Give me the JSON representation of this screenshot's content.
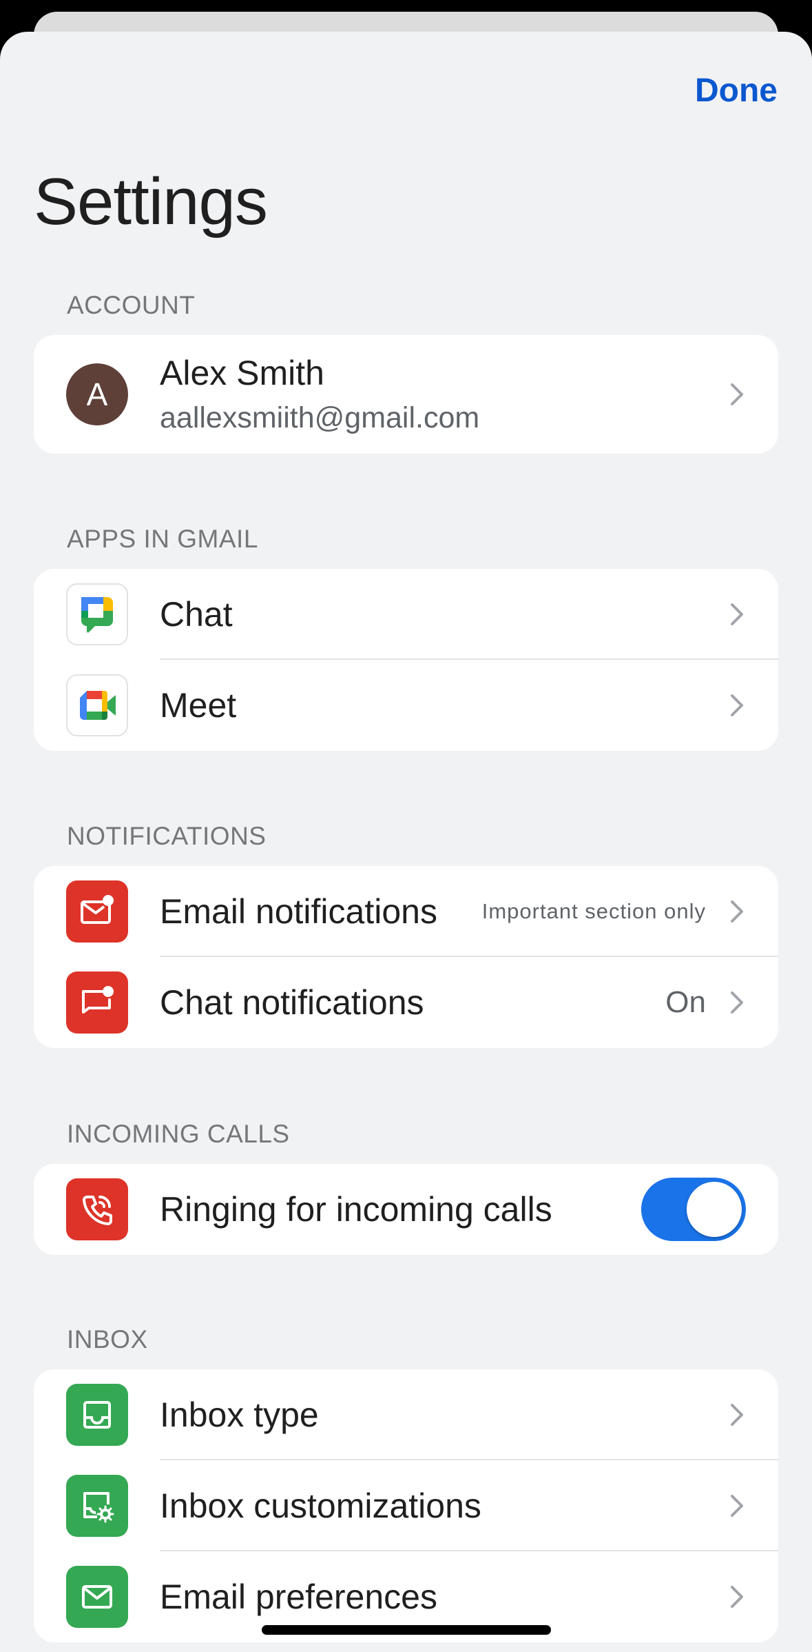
{
  "header": {
    "done_label": "Done",
    "title": "Settings"
  },
  "account": {
    "section_label": "ACCOUNT",
    "avatar_initial": "A",
    "avatar_color": "#5e4039",
    "name": "Alex Smith",
    "email": "aallexsmiith@gmail.com"
  },
  "apps": {
    "section_label": "APPS IN GMAIL",
    "items": [
      {
        "label": "Chat",
        "icon": "google-chat-icon"
      },
      {
        "label": "Meet",
        "icon": "google-meet-icon"
      }
    ]
  },
  "notifications": {
    "section_label": "NOTIFICATIONS",
    "items": [
      {
        "label": "Email notifications",
        "value": "Important section only",
        "icon": "mail-badge-icon"
      },
      {
        "label": "Chat notifications",
        "value": "On",
        "icon": "chat-badge-icon"
      }
    ]
  },
  "incoming_calls": {
    "section_label": "INCOMING CALLS",
    "ringing": {
      "label": "Ringing for incoming calls",
      "enabled": true,
      "icon": "phone-ringing-icon"
    }
  },
  "inbox": {
    "section_label": "INBOX",
    "items": [
      {
        "label": "Inbox type",
        "icon": "inbox-tray-icon"
      },
      {
        "label": "Inbox customizations",
        "icon": "inbox-settings-icon"
      },
      {
        "label": "Email preferences",
        "icon": "envelope-icon"
      }
    ]
  },
  "colors": {
    "accent": "#0b57d0",
    "toggle_on": "#1a73e8",
    "icon_red": "#dd3328",
    "icon_green": "#34a853",
    "background": "#f1f2f4"
  }
}
